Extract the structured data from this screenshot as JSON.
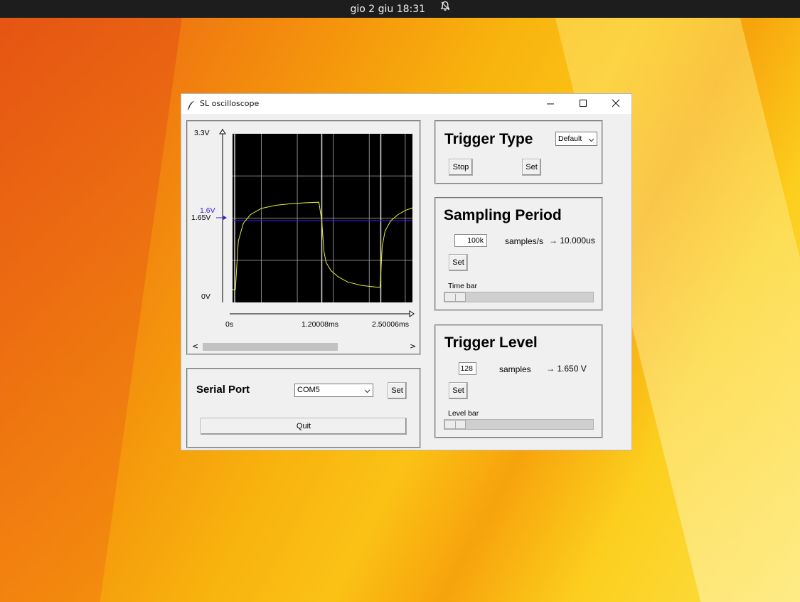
{
  "system_bar": {
    "datetime": "gio 2 giu  18:31",
    "notification_icon": "bell-icon"
  },
  "window": {
    "title": "SL oscilloscope",
    "app_icon": "feather-icon",
    "controls": {
      "minimize": "minimize-icon",
      "maximize": "maximize-icon",
      "close": "close-icon"
    }
  },
  "scope": {
    "y_labels": {
      "top": "3.3V",
      "trigger": "1.6V",
      "mid": "1.65V",
      "bottom": "0V"
    },
    "x_labels": {
      "start": "0s",
      "mid": "1.20008ms",
      "end": "2.50006ms"
    },
    "trace_color": "#e8f03a",
    "trigger_color": "#3c17d6",
    "grid_color": "#8a8a8a",
    "screen_color": "#000000"
  },
  "chart_data": {
    "type": "line",
    "title": "",
    "xlabel": "",
    "ylabel": "",
    "x_ticks": [
      "0s",
      "1.20008ms",
      "2.50006ms"
    ],
    "y_ticks": [
      "0V",
      "1.65V",
      "3.3V"
    ],
    "ylim": [
      0,
      3.3
    ],
    "trigger_level": 1.6,
    "grid": true,
    "series": [
      {
        "x": [
          0,
          0.04,
          0.08,
          0.15,
          0.25,
          0.4,
          0.6,
          0.8,
          1.0,
          1.2,
          1.24,
          1.27,
          1.3,
          1.37,
          1.47,
          1.6,
          1.8,
          2.0,
          2.05,
          2.08,
          2.12,
          2.2,
          2.3,
          2.4,
          2.5
        ],
        "y": [
          0.25,
          0.25,
          1.2,
          1.55,
          1.72,
          1.84,
          1.9,
          1.93,
          1.95,
          1.96,
          1.6,
          1.0,
          0.78,
          0.62,
          0.5,
          0.4,
          0.33,
          0.3,
          0.3,
          1.1,
          1.4,
          1.6,
          1.72,
          1.8,
          1.85
        ]
      }
    ]
  },
  "serial": {
    "title": "Serial Port",
    "port_value": "COM5",
    "set_label": "Set",
    "quit_label": "Quit"
  },
  "trigger_type": {
    "title": "Trigger Type",
    "mode_value": "Default",
    "stop_label": "Stop",
    "set_label": "Set"
  },
  "sampling": {
    "title": "Sampling Period",
    "rate_value": "100k",
    "unit_label": "samples/s",
    "period_label": "→ 10.000us",
    "set_label": "Set",
    "bar_label": "Time bar",
    "bar_level": 0.0
  },
  "trigger_level": {
    "title": "Trigger Level",
    "samples_value": "128",
    "unit_label": "samples",
    "voltage_label": "→ 1.650 V",
    "set_label": "Set",
    "bar_label": "Level bar",
    "bar_level": 0.0
  }
}
